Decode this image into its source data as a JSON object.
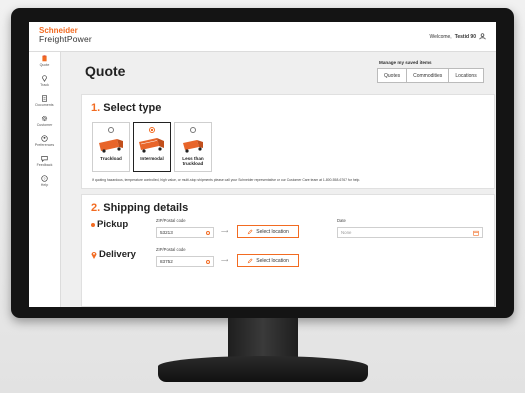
{
  "header": {
    "brand_line1": "Schneider",
    "brand_line2": "FreightPower",
    "welcome_prefix": "Welcome,",
    "welcome_user": "Testid 90"
  },
  "sidebar": {
    "items": [
      {
        "label": "Quote",
        "icon": "clipboard-icon"
      },
      {
        "label": "Track",
        "icon": "map-pin-icon"
      },
      {
        "label": "Documents",
        "icon": "document-icon"
      },
      {
        "label": "Customer",
        "icon": "gear-icon"
      },
      {
        "label": "Preferences",
        "icon": "user-circle-icon"
      },
      {
        "label": "Feedback",
        "icon": "chat-icon"
      },
      {
        "label": "Help",
        "icon": "question-icon"
      }
    ]
  },
  "page": {
    "title": "Quote",
    "saved_items_title": "Manage my saved items",
    "saved_tabs": [
      "Quotes",
      "Commodities",
      "Locations"
    ]
  },
  "select_type": {
    "number": "1.",
    "title": "Select type",
    "options": [
      {
        "label": "Truckload",
        "selected": false
      },
      {
        "label": "Intermodal",
        "selected": true
      },
      {
        "label": "Less than truckload",
        "selected": false
      }
    ],
    "disclaimer": "If quoting hazardous, temperature controlled, high value, or multi-stop shipments please call your Schneider representative or our Customer Care team at 1-800-558-6767 for help."
  },
  "shipping": {
    "number": "2.",
    "title": "Shipping details",
    "pickup": {
      "label": "Pickup",
      "zip_label": "ZIP/Postal code",
      "zip_value": "53213",
      "button": "Select location"
    },
    "delivery": {
      "label": "Delivery",
      "zip_label": "ZIP/Postal code",
      "zip_value": "83752",
      "button": "Select location"
    },
    "date": {
      "label": "Date",
      "placeholder": "None"
    }
  },
  "colors": {
    "accent": "#f26b21",
    "text": "#222222",
    "background": "#efefef"
  }
}
